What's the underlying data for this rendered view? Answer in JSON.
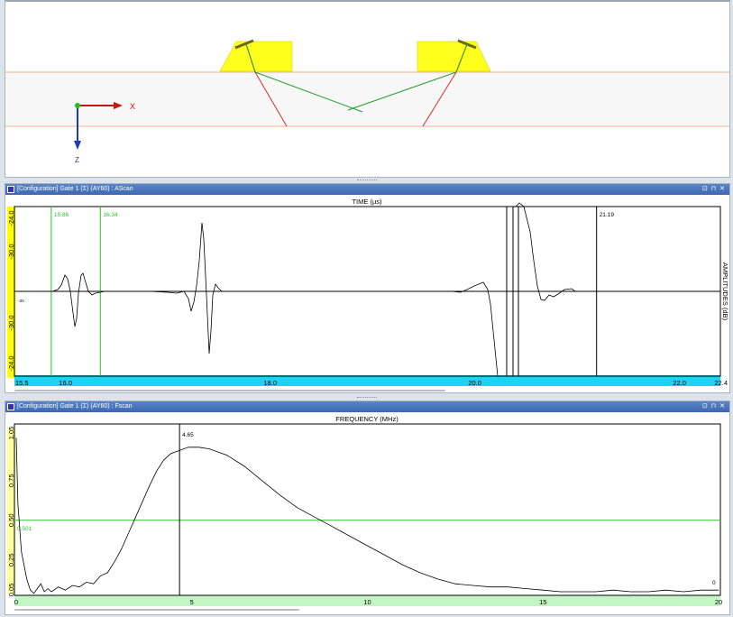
{
  "view3d": {
    "axis_x_label": "X",
    "axis_z_label": "Z"
  },
  "ascan": {
    "title": "[Configuration] Gate 1 (Σ) (AY60) : AScan",
    "window_controls": "⊡ ⊓ ✕",
    "chart_data": {
      "type": "line",
      "title": "TIME (µs)",
      "xlabel": "TIME (µs)",
      "ylabel": "AMPLITUDES (dB)",
      "xlim": [
        15.5,
        22.4
      ],
      "x_ticks": [
        "15.5",
        "16.0",
        "18.0",
        "20.0",
        "22.0",
        "22.4"
      ],
      "y_ticks": [
        "-24.0",
        "-30.0",
        "-30.0",
        "-24.0"
      ],
      "zero_label": "-.00",
      "cursors": [
        {
          "x": 15.86,
          "label": "15.86",
          "color": "#2ac42a"
        },
        {
          "x": 16.34,
          "label": "16.34",
          "color": "#2ac42a"
        },
        {
          "x": 21.19,
          "label": "21.19",
          "color": "#000000"
        }
      ],
      "grid": false
    }
  },
  "fscan": {
    "title": "[Configuration] Gate 1 (Σ) (AY60) : Fscan",
    "window_controls": "⊡ ⊓ ✕",
    "chart_data": {
      "type": "line",
      "title": "FREQUENCY (MHz)",
      "xlabel": "FREQUENCY (MHz)",
      "xlim": [
        0,
        20
      ],
      "ylim": [
        0.05,
        1.05
      ],
      "x_ticks": [
        "0",
        "5",
        "10",
        "15",
        "20"
      ],
      "y_ticks": [
        "1.05",
        "0.75",
        "0.50",
        "0.25",
        "0.05"
      ],
      "peak": {
        "x": 4.65,
        "label": "4.65"
      },
      "threshold": {
        "y": 0.5,
        "label": "0.501"
      },
      "end_label": "0",
      "points": [
        [
          0.0,
          1.02
        ],
        [
          0.05,
          0.6
        ],
        [
          0.15,
          0.3
        ],
        [
          0.3,
          0.13
        ],
        [
          0.4,
          0.06
        ],
        [
          0.5,
          0.04
        ],
        [
          0.6,
          0.07
        ],
        [
          0.7,
          0.1
        ],
        [
          0.8,
          0.05
        ],
        [
          0.9,
          0.07
        ],
        [
          1.0,
          0.05
        ],
        [
          1.2,
          0.08
        ],
        [
          1.4,
          0.06
        ],
        [
          1.6,
          0.09
        ],
        [
          1.8,
          0.08
        ],
        [
          2.0,
          0.11
        ],
        [
          2.2,
          0.1
        ],
        [
          2.4,
          0.15
        ],
        [
          2.6,
          0.17
        ],
        [
          2.8,
          0.24
        ],
        [
          3.0,
          0.32
        ],
        [
          3.2,
          0.42
        ],
        [
          3.4,
          0.52
        ],
        [
          3.6,
          0.62
        ],
        [
          3.8,
          0.72
        ],
        [
          4.0,
          0.81
        ],
        [
          4.2,
          0.88
        ],
        [
          4.4,
          0.92
        ],
        [
          4.65,
          0.94
        ],
        [
          4.9,
          0.96
        ],
        [
          5.2,
          0.96
        ],
        [
          5.5,
          0.95
        ],
        [
          6.0,
          0.91
        ],
        [
          6.5,
          0.84
        ],
        [
          7.0,
          0.75
        ],
        [
          7.5,
          0.66
        ],
        [
          8.0,
          0.58
        ],
        [
          8.5,
          0.52
        ],
        [
          9.0,
          0.46
        ],
        [
          9.5,
          0.4
        ],
        [
          10.0,
          0.34
        ],
        [
          10.5,
          0.28
        ],
        [
          11.0,
          0.22
        ],
        [
          11.5,
          0.17
        ],
        [
          12.0,
          0.13
        ],
        [
          12.5,
          0.1
        ],
        [
          13.0,
          0.09
        ],
        [
          13.5,
          0.08
        ],
        [
          14.0,
          0.08
        ],
        [
          14.5,
          0.07
        ],
        [
          15.0,
          0.06
        ],
        [
          15.5,
          0.05
        ],
        [
          16.0,
          0.05
        ],
        [
          16.5,
          0.05
        ],
        [
          17.0,
          0.06
        ],
        [
          17.5,
          0.05
        ],
        [
          18.0,
          0.05
        ],
        [
          18.5,
          0.06
        ],
        [
          19.0,
          0.05
        ],
        [
          19.5,
          0.06
        ],
        [
          20.0,
          0.06
        ]
      ],
      "grid": false
    }
  }
}
